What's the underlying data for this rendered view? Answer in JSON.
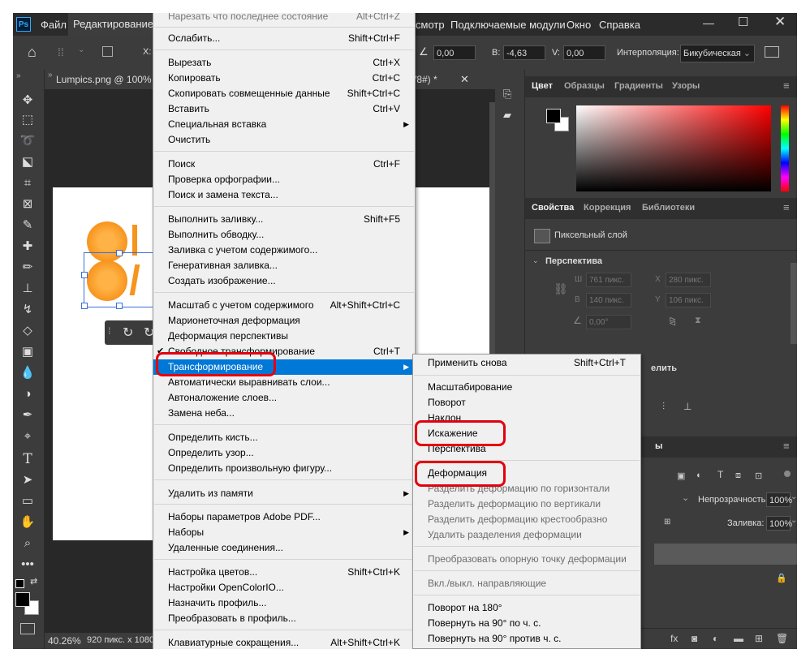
{
  "menubar": {
    "app_icon": "Ps",
    "items": [
      "Файл",
      "Редактирование",
      "смотр",
      "Подключаемые модули",
      "Окно",
      "Справка"
    ]
  },
  "options": {
    "angle_value": "0,00",
    "b_label": "B:",
    "b_value": "-4,63",
    "v_label": "V:",
    "v_value": "0,00",
    "interp_label": "Интерполяция:",
    "interp_value": "Бикубическая",
    "x_label": "X:"
  },
  "doc": {
    "tab1": "Lumpics.png @ 100% (",
    "tab2": "/8#) *",
    "zoom": "40.26%",
    "status": "920 пикс. x 1080"
  },
  "panels": {
    "color_tabs": [
      "Цвет",
      "Образцы",
      "Градиенты",
      "Узоры"
    ],
    "props_tabs": [
      "Свойства",
      "Коррекция",
      "Библиотеки"
    ],
    "pixel_layer": "Пиксельный слой",
    "perspective": "Перспектива",
    "w_label": "Ш",
    "w_value": "761 пикс.",
    "x_label": "X",
    "x_value": "280 пикс.",
    "h_label": "В",
    "h_value": "140 пикс.",
    "y_label": "Y",
    "y_value": "106 пикс.",
    "angle_value": "0,00°",
    "partial_label": "елить",
    "partial_tab": "ы",
    "opacity_label": "Непрозрачность:",
    "opacity_value": "100%",
    "fill_label": "Заливка:",
    "fill_value": "100%"
  },
  "edit_menu": {
    "items": [
      {
        "label": "Ослабить...",
        "shortcut": "Shift+Ctrl+F"
      },
      {
        "label": "Вырезать",
        "shortcut": "Ctrl+X"
      },
      {
        "label": "Копировать",
        "shortcut": "Ctrl+C"
      },
      {
        "label": "Скопировать совмещенные данные",
        "shortcut": "Shift+Ctrl+C"
      },
      {
        "label": "Вставить",
        "shortcut": "Ctrl+V"
      },
      {
        "label": "Специальная вставка",
        "shortcut": ""
      },
      {
        "label": "Очистить",
        "shortcut": ""
      },
      {
        "label": "Поиск",
        "shortcut": "Ctrl+F"
      },
      {
        "label": "Проверка орфографии...",
        "shortcut": ""
      },
      {
        "label": "Поиск и замена текста...",
        "shortcut": ""
      },
      {
        "label": "Выполнить заливку...",
        "shortcut": "Shift+F5"
      },
      {
        "label": "Выполнить обводку...",
        "shortcut": ""
      },
      {
        "label": "Заливка с учетом содержимого...",
        "shortcut": ""
      },
      {
        "label": "Генеративная заливка...",
        "shortcut": ""
      },
      {
        "label": "Создать изображение...",
        "shortcut": ""
      },
      {
        "label": "Масштаб с учетом содержимого",
        "shortcut": "Alt+Shift+Ctrl+C"
      },
      {
        "label": "Марионеточная деформация",
        "shortcut": ""
      },
      {
        "label": "Деформация перспективы",
        "shortcut": ""
      },
      {
        "label": "Свободное трансформирование",
        "shortcut": "Ctrl+T"
      },
      {
        "label": "Трансформирование",
        "shortcut": ""
      },
      {
        "label": "Автоматически выравнивать слои...",
        "shortcut": ""
      },
      {
        "label": "Автоналожение слоев...",
        "shortcut": ""
      },
      {
        "label": "Замена неба...",
        "shortcut": ""
      },
      {
        "label": "Определить кисть...",
        "shortcut": ""
      },
      {
        "label": "Определить узор...",
        "shortcut": ""
      },
      {
        "label": "Определить произвольную фигуру...",
        "shortcut": ""
      },
      {
        "label": "Удалить из памяти",
        "shortcut": ""
      },
      {
        "label": "Наборы параметров Adobe PDF...",
        "shortcut": ""
      },
      {
        "label": "Наборы",
        "shortcut": ""
      },
      {
        "label": "Удаленные соединения...",
        "shortcut": ""
      },
      {
        "label": "Настройка цветов...",
        "shortcut": "Shift+Ctrl+K"
      },
      {
        "label": "Настройки OpenColorIO...",
        "shortcut": ""
      },
      {
        "label": "Назначить профиль...",
        "shortcut": ""
      },
      {
        "label": "Преобразовать в профиль...",
        "shortcut": ""
      },
      {
        "label": "Клавиатурные сокращения...",
        "shortcut": "Alt+Shift+Ctrl+K"
      }
    ]
  },
  "transform_menu": {
    "items": [
      {
        "label": "Применить снова",
        "shortcut": "Shift+Ctrl+T"
      },
      {
        "label": "Масштабирование",
        "shortcut": ""
      },
      {
        "label": "Поворот",
        "shortcut": ""
      },
      {
        "label": "Наклон",
        "shortcut": ""
      },
      {
        "label": "Искажение",
        "shortcut": ""
      },
      {
        "label": "Перспектива",
        "shortcut": ""
      },
      {
        "label": "Деформация",
        "shortcut": ""
      },
      {
        "label": "Разделить деформацию по горизонтали",
        "shortcut": ""
      },
      {
        "label": "Разделить деформацию по вертикали",
        "shortcut": ""
      },
      {
        "label": "Разделить деформацию крестообразно",
        "shortcut": ""
      },
      {
        "label": "Удалить разделения деформации",
        "shortcut": ""
      },
      {
        "label": "Преобразовать опорную точку деформации",
        "shortcut": ""
      },
      {
        "label": "Вкл./выкл. направляющие",
        "shortcut": ""
      },
      {
        "label": "Поворот на 180°",
        "shortcut": ""
      },
      {
        "label": "Повернуть на 90° по ч. с.",
        "shortcut": ""
      },
      {
        "label": "Повернуть на 90° против ч. с.",
        "shortcut": ""
      }
    ]
  },
  "colors": {
    "highlight": "#0078d7",
    "annotation": "#e3000f",
    "orange": "#f7941d"
  }
}
